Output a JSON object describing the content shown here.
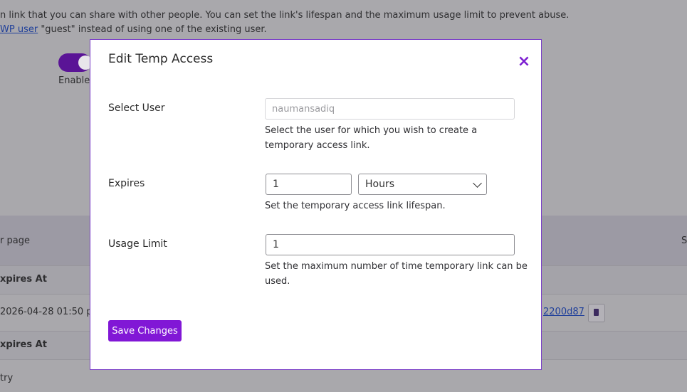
{
  "background": {
    "intro_line_1": "n link that you can share with other people. You can set the link's lifespan and the maximum usage limit to prevent abuse.",
    "intro_line_2_link": "WP user",
    "intro_line_2_rest": " \"guest\" instead of using one of the existing user.",
    "toggle_label": "Enable",
    "per_page": "r page",
    "header_expires": "xpires At",
    "row_date": "2026-04-28 01:50 pm",
    "row_link": "2200d87",
    "footer_expires": "xpires At",
    "entry": "try",
    "right_letter": "S"
  },
  "modal": {
    "title": "Edit Temp Access",
    "close": "×",
    "select_user": {
      "label": "Select User",
      "placeholder": "naumansadiq",
      "help": "Select the user for which you wish to create a temporary access link."
    },
    "expires": {
      "label": "Expires",
      "value": "1",
      "unit": "Hours",
      "help": "Set the temporary access link lifespan."
    },
    "usage_limit": {
      "label": "Usage Limit",
      "value": "1",
      "help": "Set the maximum number of time temporary link can be used."
    },
    "save_label": "Save Changes"
  },
  "colors": {
    "accent": "#8117d6",
    "overlay": "#a9a8ac"
  }
}
